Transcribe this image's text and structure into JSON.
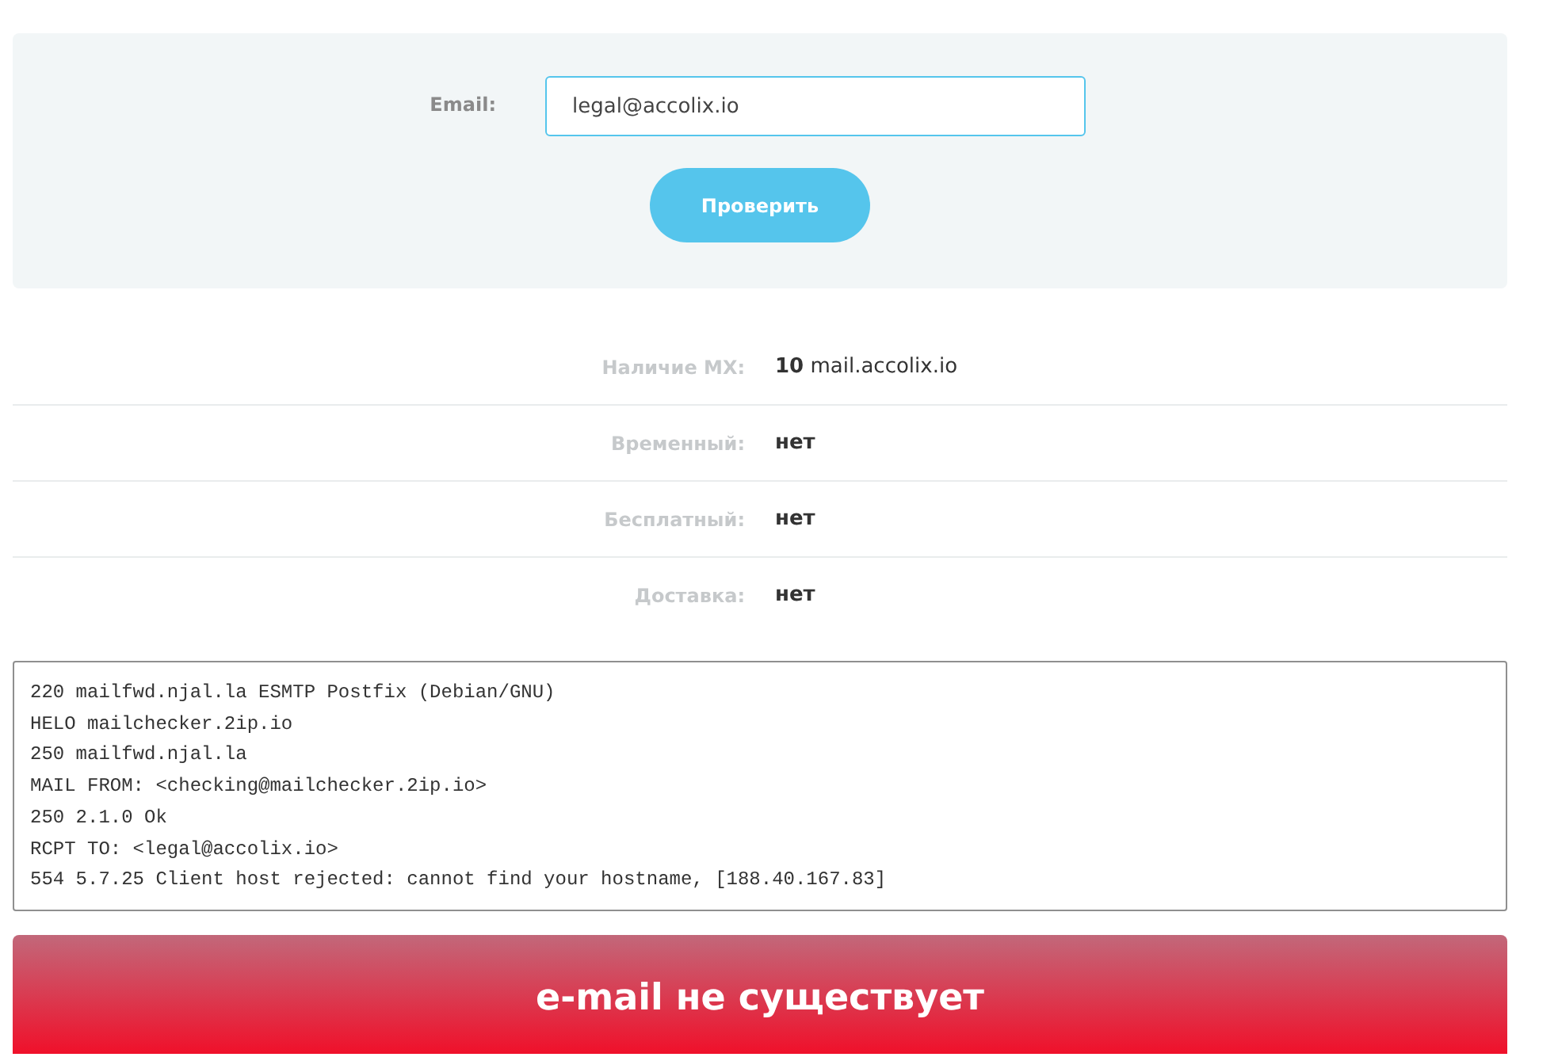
{
  "form": {
    "email_label": "Email:",
    "email_value": "legal@accolix.io",
    "submit": "Проверить"
  },
  "results": [
    {
      "kind": "record",
      "label": "Наличие MX:",
      "value": "**10** mail.accolix.io"
    },
    {
      "kind": "flag",
      "label": "Временный:",
      "value": "нет"
    },
    {
      "kind": "flag",
      "label": "Бесплатный:",
      "value": "нет"
    },
    {
      "kind": "flag",
      "label": "Доставка:",
      "value": "нет"
    }
  ],
  "smtp_log": [
    "220 mailfwd.njal.la ESMTP Postfix (Debian/GNU)",
    "HELO mailchecker.2ip.io",
    "250 mailfwd.njal.la",
    "MAIL FROM: <checking@mailchecker.2ip.io>",
    "250 2.1.0 Ok",
    "RCPT TO: <legal@accolix.io>",
    "554 5.7.25 Client host rejected: cannot find your hostname, [188.40.167.83]"
  ],
  "verdict": {
    "kind": "error",
    "text": "e-mail не существует"
  }
}
